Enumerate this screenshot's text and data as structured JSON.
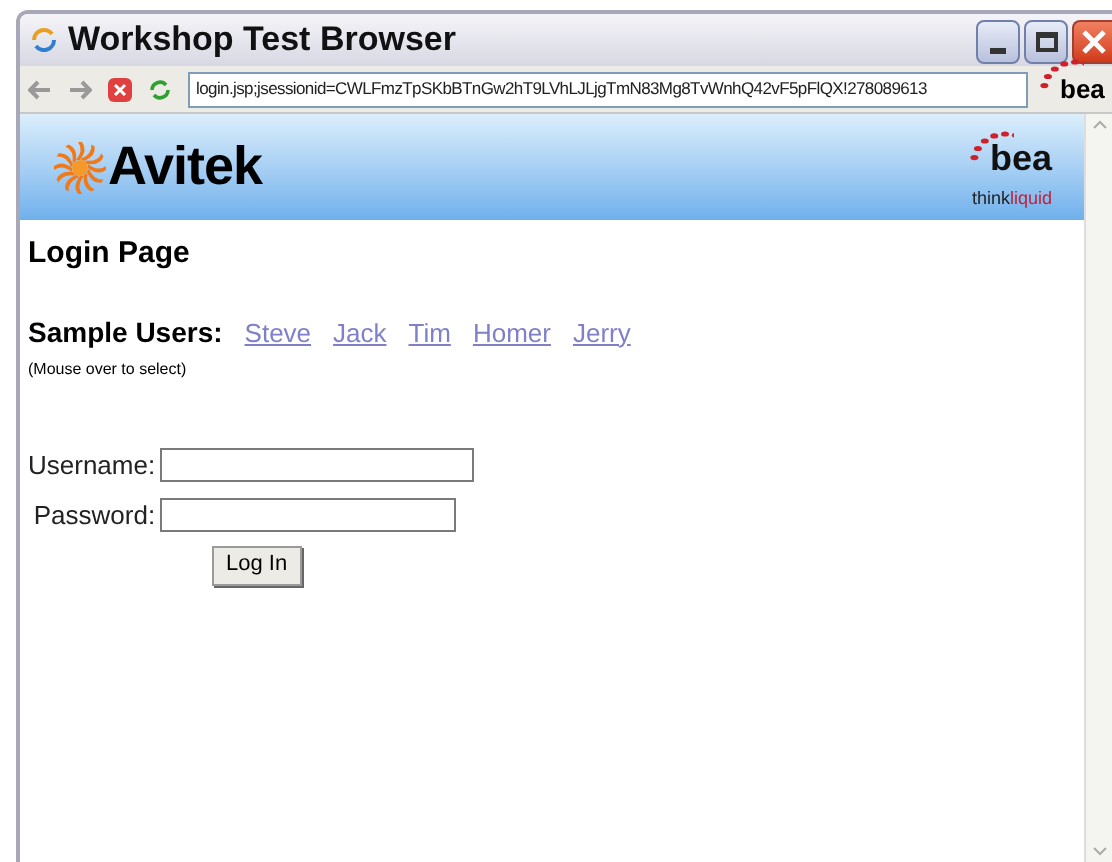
{
  "window": {
    "title": "Workshop Test Browser"
  },
  "toolbar": {
    "address": "login.jsp;jsessionid=CWLFmzTpSKbBTnGw2hT9LVhLJLjgTmN83Mg8TvWnhQ42vF5pFlQX!278089613",
    "brand": "bea"
  },
  "banner": {
    "logo": "Avitek",
    "partner_logo": "bea",
    "tagline_first": "think",
    "tagline_second": "liquid"
  },
  "page": {
    "heading": "Login Page",
    "sample_users_label": "Sample Users:",
    "sample_users": [
      "Steve",
      "Jack",
      "Tim",
      "Homer",
      "Jerry"
    ],
    "hint": "(Mouse over to select)",
    "fields": [
      {
        "label": "Username:"
      },
      {
        "label": "Password:"
      }
    ],
    "submit": "Log In"
  }
}
